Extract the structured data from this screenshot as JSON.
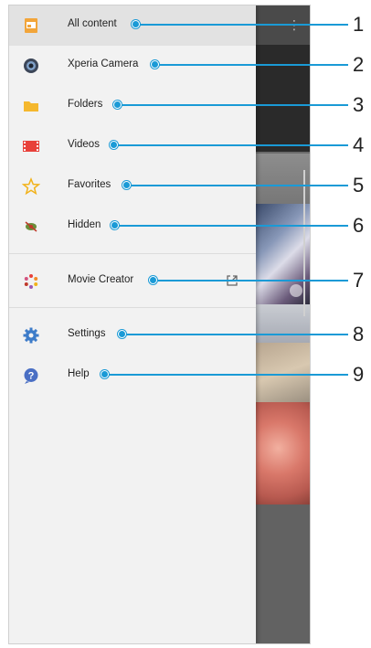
{
  "drawer": {
    "items": [
      {
        "label": "All content",
        "icon": "all-content-icon"
      },
      {
        "label": "Xperia Camera",
        "icon": "camera-icon"
      },
      {
        "label": "Folders",
        "icon": "folder-icon"
      },
      {
        "label": "Videos",
        "icon": "film-icon"
      },
      {
        "label": "Favorites",
        "icon": "star-icon"
      },
      {
        "label": "Hidden",
        "icon": "hidden-eye-icon"
      },
      {
        "label": "Movie Creator",
        "icon": "movie-creator-icon"
      },
      {
        "label": "Settings",
        "icon": "gear-icon"
      },
      {
        "label": "Help",
        "icon": "help-icon"
      }
    ]
  },
  "callouts": [
    "1",
    "2",
    "3",
    "4",
    "5",
    "6",
    "7",
    "8",
    "9"
  ],
  "colors": {
    "accent": "#1a9ad6",
    "drawer_bg": "#f2f2f2",
    "selected_bg": "#e2e2e2"
  }
}
